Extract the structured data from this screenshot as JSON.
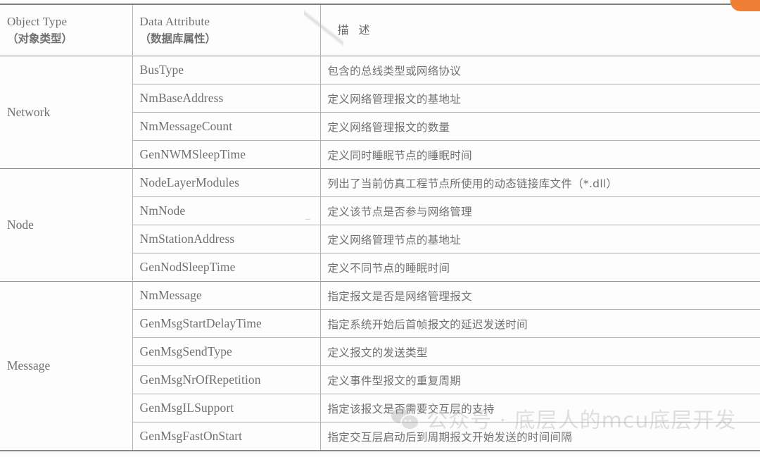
{
  "document": {
    "kind": "scanned-table-page",
    "accent_color": "#ee7f35",
    "text_color": "#70706f"
  },
  "table": {
    "headers": {
      "object_type_en": "Object Type",
      "object_type_zh": "（对象类型）",
      "data_attribute_en": "Data Attribute",
      "data_attribute_zh": "（数据库属性）",
      "description_zh": "描述"
    },
    "groups": [
      {
        "object_type": "Network",
        "rows": [
          {
            "attribute": "BusType",
            "description": "包含的总线类型或网络协议"
          },
          {
            "attribute": "NmBaseAddress",
            "description": "定义网络管理报文的基地址"
          },
          {
            "attribute": "NmMessageCount",
            "description": "定义网络管理报文的数量"
          },
          {
            "attribute": "GenNWMSleepTime",
            "description": "定义同时睡眠节点的睡眠时间"
          }
        ]
      },
      {
        "object_type": "Node",
        "rows": [
          {
            "attribute": "NodeLayerModules",
            "description": "列出了当前仿真工程节点所使用的动态链接库文件（*.dll）"
          },
          {
            "attribute": "NmNode",
            "description": "定义该节点是否参与网络管理"
          },
          {
            "attribute": "NmStationAddress",
            "description": "定义网络管理节点的基地址"
          },
          {
            "attribute": "GenNodSleepTime",
            "description": "定义不同节点的睡眠时间"
          }
        ]
      },
      {
        "object_type": "Message",
        "rows": [
          {
            "attribute": "NmMessage",
            "description": "指定报文是否是网络管理报文"
          },
          {
            "attribute": "GenMsgStartDelayTime",
            "description": "指定系统开始后首帧报文的延迟发送时间"
          },
          {
            "attribute": "GenMsgSendType",
            "description": "定义报文的发送类型"
          },
          {
            "attribute": "GenMsgNrOfRepetition",
            "description": "定义事件型报文的重复周期"
          },
          {
            "attribute": "GenMsgILSupport",
            "description": "指定该报文是否需要交互层的支持"
          },
          {
            "attribute": "GenMsgFastOnStart",
            "description": "指定交互层启动后到周期报文开始发送的时间间隔"
          }
        ]
      }
    ]
  },
  "watermark": {
    "text": "公众号 · 底层人的mcu底层开发",
    "logo": "wechat-bubbles-icon"
  }
}
